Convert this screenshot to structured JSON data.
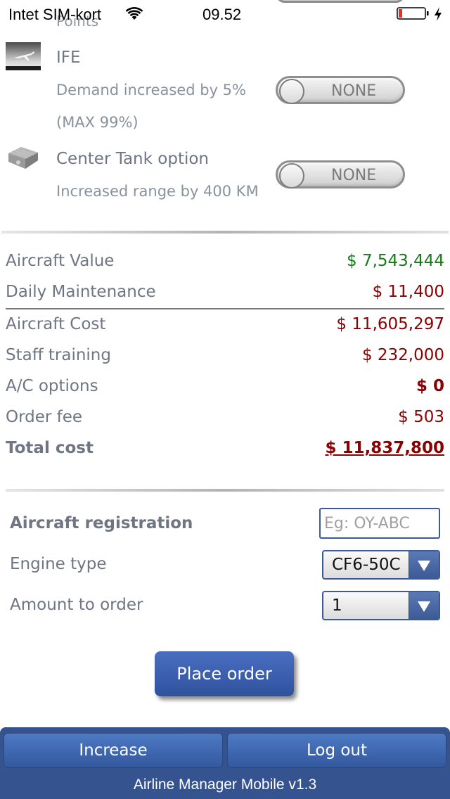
{
  "status_bar": {
    "carrier": "Intet SIM-kort",
    "time": "09.52",
    "battery_level": 0.15,
    "charging": true,
    "icons": [
      "wifi-icon",
      "battery-icon",
      "charging-bolt-icon"
    ]
  },
  "partial_top_text": "Points",
  "options": [
    {
      "icon": "ife-airplane-icon",
      "title": "IFE",
      "desc_lines": [
        "Demand increased by 5%",
        "(MAX 99%)"
      ],
      "toggle_label": "NONE",
      "toggle_on": false
    },
    {
      "icon": "center-tank-icon",
      "title": "Center Tank option",
      "desc_lines": [
        "Increased range by 400 KM"
      ],
      "toggle_label": "NONE",
      "toggle_on": false
    }
  ],
  "costs": {
    "aircraft_value": {
      "label": "Aircraft Value",
      "value": "$ 7,543,444",
      "color": "#1a7a1a"
    },
    "daily_maintenance": {
      "label": "Daily Maintenance",
      "value": "$ 11,400",
      "color": "#8b0000"
    },
    "aircraft_cost": {
      "label": "Aircraft Cost",
      "value": "$ 11,605,297",
      "color": "#8b0000"
    },
    "staff_training": {
      "label": "Staff training",
      "value": "$ 232,000",
      "color": "#8b0000"
    },
    "ac_options": {
      "label": "A/C options",
      "value": "$ 0",
      "color": "#8b0000"
    },
    "order_fee": {
      "label": "Order fee",
      "value": "$ 503",
      "color": "#8b0000"
    },
    "total_cost": {
      "label": "Total cost",
      "value": "$ 11,837,800",
      "color": "#8b0000"
    }
  },
  "form": {
    "registration_label": "Aircraft registration",
    "registration_placeholder": "Eg: OY-ABC",
    "registration_value": "",
    "engine_label": "Engine type",
    "engine_value": "CF6-50C",
    "amount_label": "Amount to order",
    "amount_value": "1",
    "place_order": "Place order"
  },
  "footer": {
    "increase": "Increase",
    "logout": "Log out",
    "version": "Airline Manager Mobile v1.3",
    "color": "#35538f"
  }
}
